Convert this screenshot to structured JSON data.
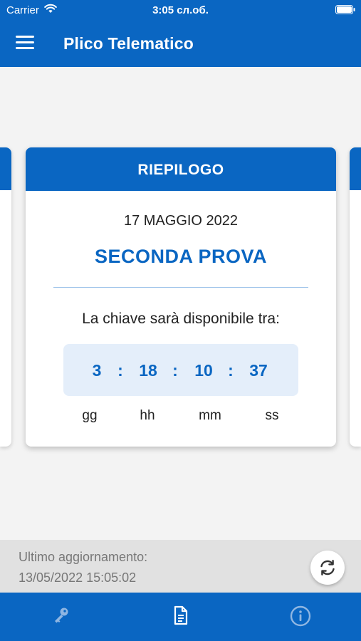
{
  "status_bar": {
    "carrier": "Carrier",
    "time": "3:05 сл.об."
  },
  "header": {
    "title": "Plico Telematico",
    "menu_icon": "hamburger-menu-icon"
  },
  "card": {
    "header": "RIEPILOGO",
    "date": "17 MAGGIO 2022",
    "exam": "SECONDA PROVA",
    "message": "La chiave sarà disponibile tra:",
    "countdown": {
      "days": "3",
      "hours": "18",
      "minutes": "10",
      "seconds": "37",
      "separator": ":",
      "labels": {
        "days": "gg",
        "hours": "hh",
        "minutes": "mm",
        "seconds": "ss"
      }
    }
  },
  "update": {
    "label": "Ultimo aggiornamento:",
    "timestamp": "13/05/2022 15:05:02",
    "refresh_icon": "refresh-icon"
  },
  "tabs": [
    {
      "icon": "key-icon",
      "active": false
    },
    {
      "icon": "document-icon",
      "active": true
    },
    {
      "icon": "info-icon",
      "active": false
    }
  ],
  "colors": {
    "primary": "#0a66c2",
    "countdown_bg": "#e4eefa",
    "tab_inactive": "#8fb6e2",
    "tab_active": "#ffffff"
  }
}
